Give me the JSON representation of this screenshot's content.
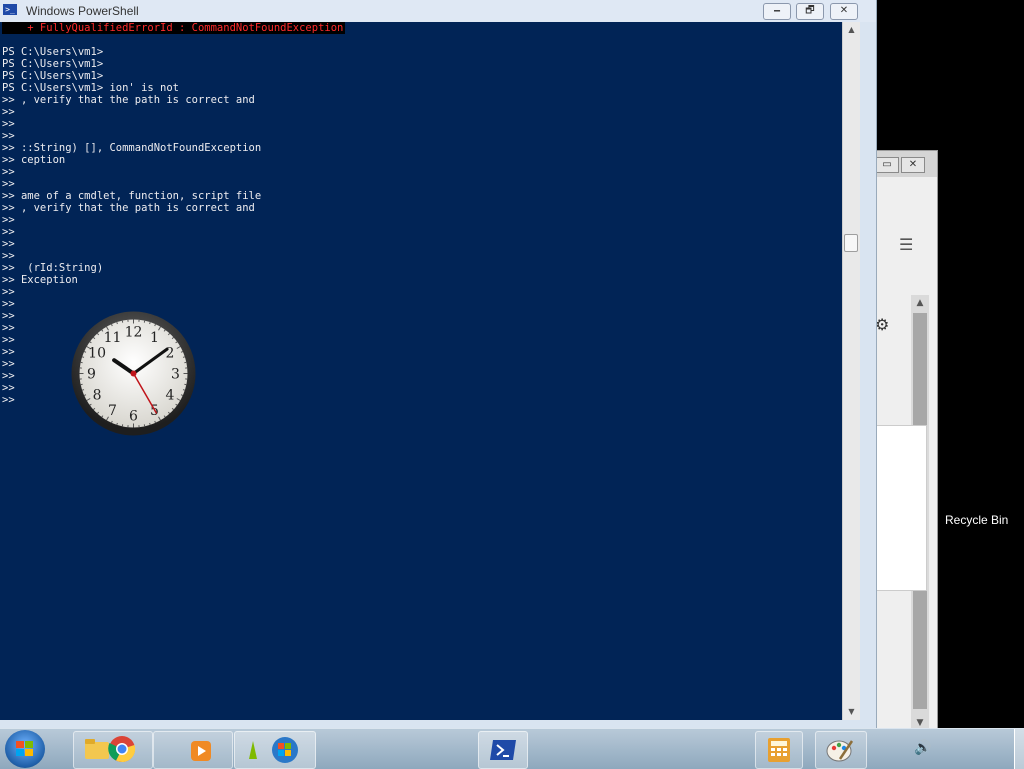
{
  "window": {
    "title": "Windows PowerShell",
    "minimize_label": "🗕",
    "maximize_label": "🗗",
    "close_label": "✕"
  },
  "console": {
    "error_line": "    + FullyQualifiedErrorId : CommandNotFoundException",
    "lines": [
      "",
      "PS C:\\Users\\vm1>",
      "PS C:\\Users\\vm1>",
      "PS C:\\Users\\vm1>",
      "PS C:\\Users\\vm1> ion' is not",
      ">> , verify that the path is correct and",
      ">>",
      ">>",
      ">>",
      ">> ::String) [], CommandNotFoundException",
      ">> ception",
      ">>",
      ">>",
      ">> ame of a cmdlet, function, script file",
      ">> , verify that the path is correct and",
      ">>",
      ">>",
      ">>",
      ">>",
      ">>  (rId:String)",
      ">> Exception",
      ">>",
      ">>",
      ">>",
      ">>",
      ">>",
      ">>",
      ">>",
      ">>",
      ">>",
      ">>"
    ]
  },
  "clock": {
    "numerals": [
      "12",
      "1",
      "2",
      "3",
      "4",
      "5",
      "6",
      "7",
      "8",
      "9",
      "10",
      "11"
    ],
    "hour": 10,
    "minute": 9,
    "second": 25
  },
  "desktop": {
    "recycle_bin_label": "Recycle Bin"
  },
  "background_window": {
    "menu_icon": "☰",
    "gear_icon": "⚙"
  },
  "taskbar": {
    "items": [
      {
        "name": "start-button",
        "icon": "windows-orb"
      },
      {
        "name": "explorer",
        "icon": "folder-icon"
      },
      {
        "name": "chrome",
        "icon": "chrome-icon"
      },
      {
        "name": "media-player",
        "icon": "media-player-icon"
      },
      {
        "name": "paint",
        "icon": "paint-icon"
      },
      {
        "name": "windows-media",
        "icon": "windows-logo-icon"
      },
      {
        "name": "powershell",
        "icon": "powershell-icon"
      },
      {
        "name": "calculator",
        "icon": "calculator-icon"
      },
      {
        "name": "paint-app",
        "icon": "palette-icon"
      }
    ],
    "volume_icon": "🔊"
  }
}
